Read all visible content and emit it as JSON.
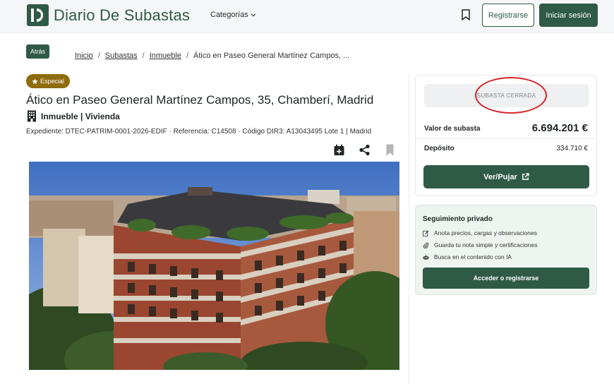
{
  "header": {
    "brand": "Diario De Subastas",
    "nav_categories": "Categorías",
    "register_label": "Registrarse",
    "login_label": "Iniciar sesión"
  },
  "nav": {
    "back_label": "Atrás",
    "breadcrumb": [
      "Inicio",
      "Subastas",
      "Inmueble",
      "Ático en Paseo General Martínez Campos, ..."
    ]
  },
  "listing": {
    "badge": "Especial",
    "title": "Ático en Paseo General Martínez Campos, 35, Chamberí, Madrid",
    "category": "Inmueble | Vivienda",
    "meta": "Expediente: DTEC-PATRIM-0001-2026-EDIF · Referencia: C14508 · Código DIR3: A13043495 Lote 1 | Madrid",
    "action_icons": [
      "calendar-add-icon",
      "share-icon",
      "bookmark-icon"
    ]
  },
  "auction": {
    "status": "SUBASTA CERRADA",
    "value_label": "Valor de subasta",
    "value": "6.694.201 €",
    "deposit_label": "Depósito",
    "deposit": "334.710 €",
    "bid_label": "Ver/Pujar"
  },
  "follow": {
    "title": "Seguimiento privado",
    "features": [
      {
        "icon": "edit-icon",
        "text": "Anota precios, cargas y observaciones"
      },
      {
        "icon": "paperclip-icon",
        "text": "Guarda tu nota simple y certificaciones"
      },
      {
        "icon": "robot-icon",
        "text": "Busca en el contenido con IA"
      }
    ],
    "cta_label": "Acceder o registrarse"
  },
  "colors": {
    "brand": "#2f5a46",
    "badge": "#8e6b0d",
    "status_circle": "#d8262a"
  }
}
